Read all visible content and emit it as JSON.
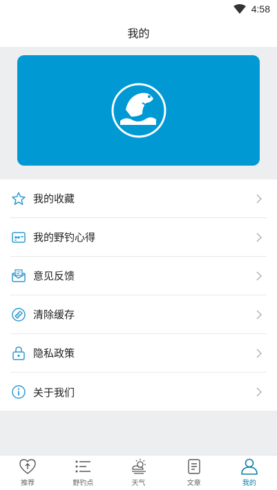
{
  "status_bar": {
    "time": "4:58",
    "icons": [
      "wifi-icon"
    ]
  },
  "header": {
    "title": "我的"
  },
  "banner": {
    "logo_icon": "fish-logo-icon",
    "color": "#0099d4"
  },
  "menu": {
    "items": [
      {
        "label": "我的收藏",
        "icon": "star-icon"
      },
      {
        "label": "我的野钓心得",
        "icon": "notes-card-icon"
      },
      {
        "label": "意见反馈",
        "icon": "mail-feedback-icon"
      },
      {
        "label": "清除缓存",
        "icon": "clean-icon"
      },
      {
        "label": "隐私政策",
        "icon": "lock-icon"
      },
      {
        "label": "关于我们",
        "icon": "info-icon"
      }
    ],
    "icon_color": "#2e9ad0"
  },
  "tabbar": {
    "tabs": [
      {
        "label": "推荐",
        "icon": "heart-arrow-icon",
        "active": false
      },
      {
        "label": "野钓点",
        "icon": "list-icon",
        "active": false
      },
      {
        "label": "天气",
        "icon": "weather-icon",
        "active": false
      },
      {
        "label": "文章",
        "icon": "article-icon",
        "active": false
      },
      {
        "label": "我的",
        "icon": "person-icon",
        "active": true
      }
    ],
    "active_color": "#0a7fa6"
  }
}
